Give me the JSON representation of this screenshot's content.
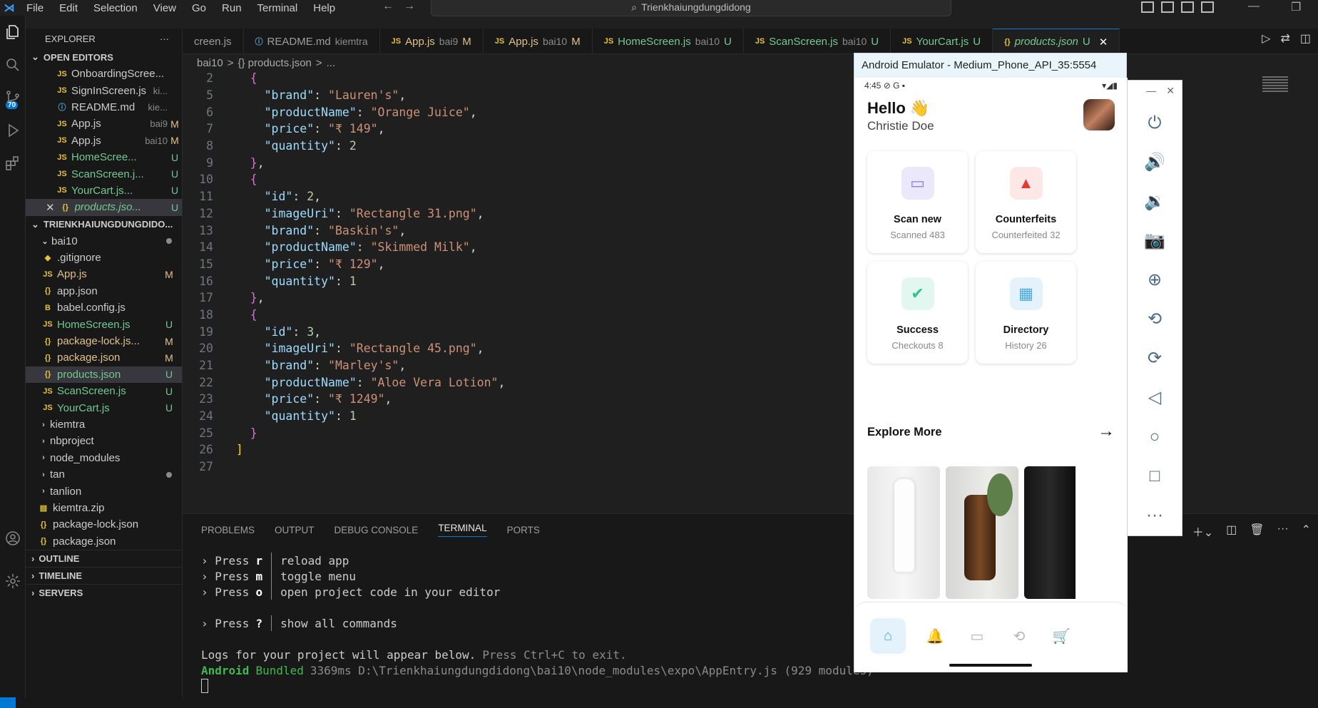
{
  "menu": [
    "File",
    "Edit",
    "Selection",
    "View",
    "Go",
    "Run",
    "Terminal",
    "Help"
  ],
  "search": {
    "text": "Trienkhaiungdungdidong"
  },
  "activity": {
    "badge": "70"
  },
  "sidebar": {
    "title": "EXPLORER",
    "more": "···",
    "open_editors_label": "OPEN EDITORS",
    "open_editors": [
      {
        "icon": "JS",
        "name": "OnboardingScree...",
        "sub": "",
        "status": ""
      },
      {
        "icon": "JS",
        "name": "SignInScreen.js",
        "sub": "ki...",
        "status": ""
      },
      {
        "icon": "ⓘ",
        "name": "README.md",
        "sub": "kie...",
        "status": ""
      },
      {
        "icon": "JS",
        "name": "App.js",
        "sub": "bai9",
        "status": "M"
      },
      {
        "icon": "JS",
        "name": "App.js",
        "sub": "bai10",
        "status": "M"
      },
      {
        "icon": "JS",
        "name": "HomeScree...",
        "sub": "",
        "status": "U"
      },
      {
        "icon": "JS",
        "name": "ScanScreen.j...",
        "sub": "",
        "status": "U"
      },
      {
        "icon": "JS",
        "name": "YourCart.js...",
        "sub": "",
        "status": "U"
      },
      {
        "icon": "{}",
        "name": "products.jso...",
        "sub": "",
        "status": "U"
      }
    ],
    "project_label": "TRIENKHAIUNGDUNGDIDO...",
    "folder": "bai10",
    "files": [
      {
        "icon": "◆",
        "name": ".gitignore",
        "status": ""
      },
      {
        "icon": "JS",
        "name": "App.js",
        "status": "M"
      },
      {
        "icon": "{}",
        "name": "app.json",
        "status": ""
      },
      {
        "icon": "B",
        "name": "babel.config.js",
        "status": ""
      },
      {
        "icon": "JS",
        "name": "HomeScreen.js",
        "status": "U"
      },
      {
        "icon": "{}",
        "name": "package-lock.js...",
        "status": "M"
      },
      {
        "icon": "{}",
        "name": "package.json",
        "status": "M"
      },
      {
        "icon": "{}",
        "name": "products.json",
        "status": "U"
      },
      {
        "icon": "JS",
        "name": "ScanScreen.js",
        "status": "U"
      },
      {
        "icon": "JS",
        "name": "YourCart.js",
        "status": "U"
      }
    ],
    "folders": [
      "kiemtra",
      "nbproject",
      "node_modules",
      "tan",
      "tanlion"
    ],
    "root_files": [
      {
        "icon": "▤",
        "name": "kiemtra.zip"
      },
      {
        "icon": "{}",
        "name": "package-lock.json"
      },
      {
        "icon": "{}",
        "name": "package.json"
      }
    ],
    "outline": "OUTLINE",
    "timeline": "TIMELINE",
    "servers": "SERVERS"
  },
  "tabs": [
    {
      "icon": "",
      "name": "creen.js",
      "dir": "",
      "status": ""
    },
    {
      "icon": "ⓘ",
      "name": "README.md",
      "dir": "kiemtra",
      "status": ""
    },
    {
      "icon": "JS",
      "name": "App.js",
      "dir": "bai9",
      "status": "M"
    },
    {
      "icon": "JS",
      "name": "App.js",
      "dir": "bai10",
      "status": "M"
    },
    {
      "icon": "JS",
      "name": "HomeScreen.js",
      "dir": "bai10",
      "status": "U"
    },
    {
      "icon": "JS",
      "name": "ScanScreen.js",
      "dir": "bai10",
      "status": "U"
    },
    {
      "icon": "JS",
      "name": "YourCart.js",
      "dir": "",
      "status": "U"
    },
    {
      "icon": "{}",
      "name": "products.json",
      "dir": "",
      "status": "U"
    }
  ],
  "breadcrumb": [
    "bai10",
    ">",
    "{} products.json",
    ">",
    "..."
  ],
  "code_lines": [
    {
      "n": "2",
      "t": "    {"
    },
    {
      "n": "5",
      "t": "      \"brand\": \"Lauren's\","
    },
    {
      "n": "6",
      "t": "      \"productName\": \"Orange Juice\","
    },
    {
      "n": "7",
      "t": "      \"price\": \"₹ 149\","
    },
    {
      "n": "8",
      "t": "      \"quantity\": 2"
    },
    {
      "n": "9",
      "t": "    },"
    },
    {
      "n": "10",
      "t": "    {"
    },
    {
      "n": "11",
      "t": "      \"id\": 2,"
    },
    {
      "n": "12",
      "t": "      \"imageUri\": \"Rectangle 31.png\","
    },
    {
      "n": "13",
      "t": "      \"brand\": \"Baskin's\","
    },
    {
      "n": "14",
      "t": "      \"productName\": \"Skimmed Milk\","
    },
    {
      "n": "15",
      "t": "      \"price\": \"₹ 129\","
    },
    {
      "n": "16",
      "t": "      \"quantity\": 1"
    },
    {
      "n": "17",
      "t": "    },"
    },
    {
      "n": "18",
      "t": "    {"
    },
    {
      "n": "19",
      "t": "      \"id\": 3,"
    },
    {
      "n": "20",
      "t": "      \"imageUri\": \"Rectangle 45.png\","
    },
    {
      "n": "21",
      "t": "      \"brand\": \"Marley's\","
    },
    {
      "n": "22",
      "t": "      \"productName\": \"Aloe Vera Lotion\","
    },
    {
      "n": "23",
      "t": "      \"price\": \"₹ 1249\","
    },
    {
      "n": "24",
      "t": "      \"quantity\": 1"
    },
    {
      "n": "25",
      "t": "    }"
    },
    {
      "n": "26",
      "t": "  ]"
    },
    {
      "n": "27",
      "t": ""
    }
  ],
  "panel": {
    "tabs": [
      "PROBLEMS",
      "OUTPUT",
      "DEBUG CONSOLE",
      "TERMINAL",
      "PORTS"
    ],
    "active": "TERMINAL",
    "terminal": [
      {
        "key": "r",
        "desc": "reload app"
      },
      {
        "key": "m",
        "desc": "toggle menu"
      },
      {
        "key": "o",
        "desc": "open project code in your editor"
      },
      {
        "key": "?",
        "desc": "show all commands"
      }
    ],
    "press": "› Press",
    "logs": "Logs for your project will appear below.",
    "logs_hint": "Press Ctrl+C to exit.",
    "bundled_a": "Android",
    "bundled_b": "Bundled",
    "bundled_rest": "3369ms D:\\Trienkhaiungdungdidong\\bai10\\node_modules\\expo\\AppEntry.js (929 modules)"
  },
  "emulator": {
    "title": "Android Emulator - Medium_Phone_API_35:5554",
    "time": "4:45",
    "hello": "Hello 👋",
    "user": "Christie Doe",
    "cards": [
      {
        "title": "Scan new",
        "sub": "Scanned 483",
        "color": "#ece8fb",
        "icon_color": "#8a7ae0"
      },
      {
        "title": "Counterfeits",
        "sub": "Counterfeited 32",
        "color": "#fde7e7",
        "icon_color": "#e53935"
      },
      {
        "title": "Success",
        "sub": "Checkouts 8",
        "color": "#e2f7f0",
        "icon_color": "#2bc48a"
      },
      {
        "title": "Directory",
        "sub": "History 26",
        "color": "#e4f3fb",
        "icon_color": "#45a9e1"
      }
    ],
    "explore": "Explore More"
  }
}
